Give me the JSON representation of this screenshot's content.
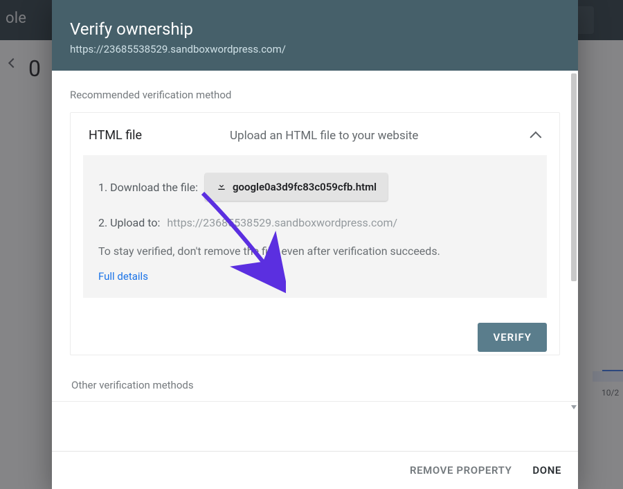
{
  "bg": {
    "logo_fragment": "ole",
    "chart_zero": "0",
    "chart_date": "10/2"
  },
  "modal": {
    "title": "Verify ownership",
    "subtitle_url": "https://23685538529.sandboxwordpress.com/"
  },
  "recommended_label": "Recommended verification method",
  "method": {
    "name": "HTML file",
    "description": "Upload an HTML file to your website",
    "step1_label": "1. Download the file:",
    "download_filename": "google0a3d9fc83c059cfb.html",
    "step2_label": "2. Upload to:",
    "step2_url": "https://23685538529.sandboxwordpress.com/",
    "note": "To stay verified, don't remove the file, even after verification succeeds.",
    "full_details": "Full details",
    "verify": "VERIFY"
  },
  "other_label": "Other verification methods",
  "footer": {
    "remove": "REMOVE PROPERTY",
    "done": "DONE"
  }
}
